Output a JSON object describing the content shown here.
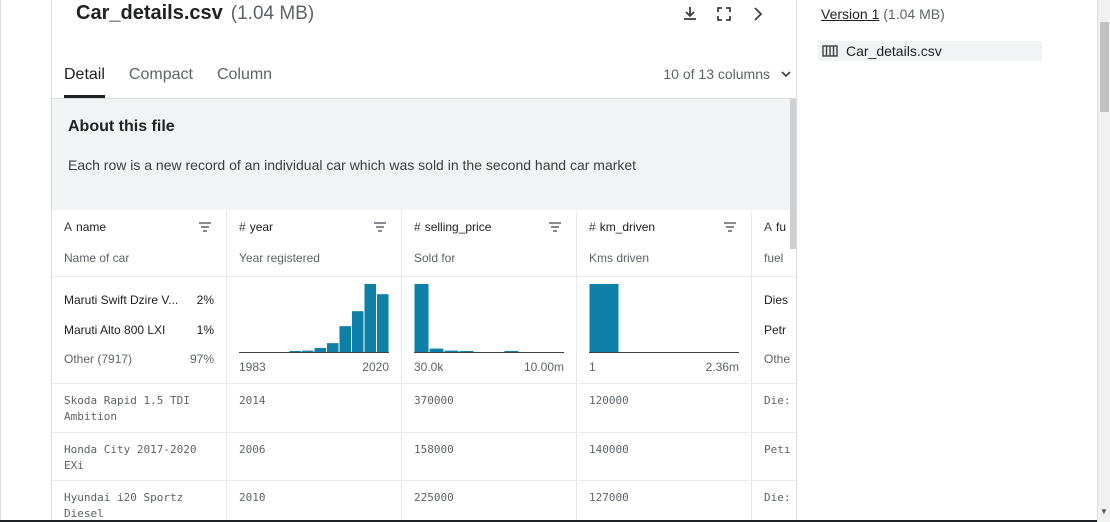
{
  "file": {
    "name": "Car_details.csv",
    "size": "(1.04 MB)"
  },
  "header_icons": [
    "download-icon",
    "expand-icon",
    "chevron-right-icon"
  ],
  "tabs": [
    {
      "label": "Detail",
      "active": true
    },
    {
      "label": "Compact",
      "active": false
    },
    {
      "label": "Column",
      "active": false
    }
  ],
  "column_count": "10 of 13 columns",
  "about": {
    "title": "About this file",
    "description": "Each row is a new record of an individual car which was sold in the second hand car market"
  },
  "columns": [
    {
      "type_icon": "A",
      "name": "name",
      "description": "Name of car"
    },
    {
      "type_icon": "#",
      "name": "year",
      "description": "Year registered"
    },
    {
      "type_icon": "#",
      "name": "selling_price",
      "description": "Sold for"
    },
    {
      "type_icon": "#",
      "name": "km_driven",
      "description": "Kms driven"
    },
    {
      "type_icon": "A",
      "name": "fu",
      "description": "fuel"
    }
  ],
  "name_stats": [
    {
      "label": "Maruti Swift Dzire V...",
      "pct": "2%"
    },
    {
      "label": "Maruti Alto 800 LXI",
      "pct": "1%"
    },
    {
      "label": "Other (7917)",
      "pct": "97%"
    }
  ],
  "fuel_stats": [
    "Dies",
    "Petr",
    "Othe"
  ],
  "histograms": {
    "year": {
      "min": "1983",
      "max": "2020",
      "bars": [
        0.0,
        0.0,
        0.0,
        0.0,
        0.01,
        0.02,
        0.06,
        0.13,
        0.38,
        0.6,
        1.0,
        0.85
      ]
    },
    "selling_price": {
      "min": "30.0k",
      "max": "10.00m",
      "bars": [
        1.0,
        0.05,
        0.02,
        0.01,
        0.0,
        0.0,
        0.01,
        0.0,
        0.0,
        0.0
      ]
    },
    "km_driven": {
      "min": "1",
      "max": "2.36m",
      "bars": [
        1.0,
        0.0,
        0.0,
        0.0,
        0.0
      ]
    }
  },
  "hist_color": "#0e7fa6",
  "rows": [
    {
      "name": "Skoda Rapid 1.5 TDI Ambition",
      "year": "2014",
      "selling_price": "370000",
      "km_driven": "120000",
      "fuel": "Die:"
    },
    {
      "name": "Honda City 2017-2020 EXi",
      "year": "2006",
      "selling_price": "158000",
      "km_driven": "140000",
      "fuel": "Petı"
    },
    {
      "name": "Hyundai i20 Sportz Diesel",
      "year": "2010",
      "selling_price": "225000",
      "km_driven": "127000",
      "fuel": "Die:"
    }
  ],
  "sidebar": {
    "version_label": "Version 1",
    "version_size": "(1.04 MB)",
    "file_item": "Car_details.csv"
  }
}
